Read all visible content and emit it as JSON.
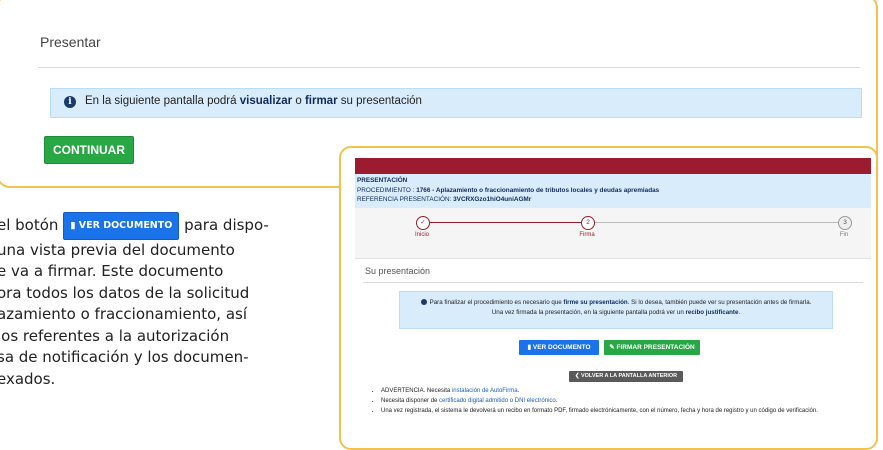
{
  "top": {
    "title": "Presentar",
    "info_pre": "En la siguiente pantalla podrá ",
    "info_b1": "visualizar",
    "info_mid": " o ",
    "info_b2": "firmar",
    "info_post": " su presentación",
    "continue_label": "CONTINUAR"
  },
  "paragraph": {
    "l1_pre": "el botón ",
    "l1_btn": "VER DOCUMENTO",
    "l1_post": " para dispo-",
    "l2": "una vista previa del documento",
    "l3": "e va a firmar. Este documento",
    "l4": "ora todos los datos de la solicitud",
    "l5": "azamiento o fraccionamiento, así",
    "l6": "los referentes a la autorización",
    "l7": "sa de notificación y los documen-",
    "l8": "exados."
  },
  "overlay": {
    "header_title": "PRESENTACIÓN",
    "proc_label": "PROCEDIMIENTO : ",
    "proc_value": "1766 - Aplazamiento o fraccionamiento de tributos locales y deudas apremiadas",
    "ref_label": "REFERENCIA PRESENTACIÓN: ",
    "ref_value": "3VCRXGzo1hiO4uniAGMr",
    "steps": [
      {
        "num": "✓",
        "label": "Inicio"
      },
      {
        "num": "2",
        "label": "Firma"
      },
      {
        "num": "3",
        "label": "Fin"
      }
    ],
    "section_title": "Su presentación",
    "alert_l1_pre": "Para finalizar el procedimiento es necesario que ",
    "alert_l1_b": "firme su presentación",
    "alert_l1_post": ". Si lo desea, también puede ver su presentación antes de firmarla.",
    "alert_l2_pre": "Una vez firmada la presentación, en la siguiente pantalla podrá ver un ",
    "alert_l2_b": "recibo justificante",
    "alert_l2_post": ".",
    "btn_ver": "VER DOCUMENTO",
    "btn_firmar": "FIRMAR PRESENTACIÓN",
    "btn_volver": "VOLVER A LA PANTALLA ANTERIOR",
    "notes": {
      "n1_pre": "ADVERTENCIA. Necesita ",
      "n1_link": "instalación de AutoFirma",
      "n1_post": ".",
      "n2_pre": "Necesita disponer de ",
      "n2_link": "certificado digital admitido o DNI electrónico",
      "n2_post": ".",
      "n3": "Una vez registrada, el sistema le devolverá un recibo en formato PDF, firmado electrónicamente, con el número, fecha y hora de registro y un código de verificación."
    }
  }
}
